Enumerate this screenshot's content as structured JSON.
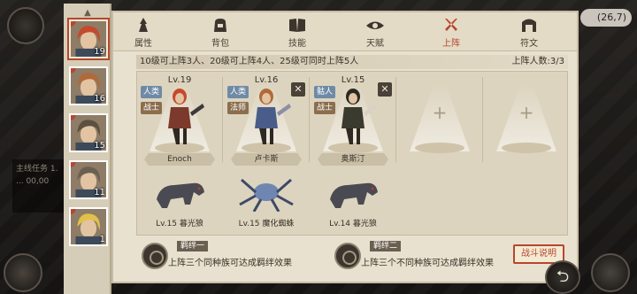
{
  "hud": {
    "coordinates": "(26,7)",
    "task_hint": "主线任务 1. ... 00,00"
  },
  "sidebar": {
    "portraits": [
      {
        "level": "19",
        "hair": "#c54a2d",
        "active": true,
        "removable": true
      },
      {
        "level": "16",
        "hair": "#b06a3a",
        "active": false,
        "removable": true
      },
      {
        "level": "15",
        "hair": "#5c503f",
        "active": false,
        "removable": true
      },
      {
        "level": "11",
        "hair": "#6a5f52",
        "active": false,
        "removable": true
      },
      {
        "level": "1",
        "hair": "#e0c24a",
        "active": false,
        "removable": true
      }
    ]
  },
  "tabs": [
    {
      "label": "属性",
      "icon": "attribute-icon",
      "active": false
    },
    {
      "label": "背包",
      "icon": "backpack-icon",
      "active": false
    },
    {
      "label": "技能",
      "icon": "skill-book-icon",
      "active": false
    },
    {
      "label": "天赋",
      "icon": "talent-eye-icon",
      "active": false
    },
    {
      "label": "上阵",
      "icon": "crossed-swords-icon",
      "active": true
    },
    {
      "label": "符文",
      "icon": "rune-gate-icon",
      "active": false
    }
  ],
  "formation": {
    "rule_text": "10级可上阵3人、20级可上阵4人、25级可同时上阵5人",
    "count_text": "上阵人数:3/3",
    "slots": [
      {
        "level": "Lv.19",
        "tags": [
          "人类",
          "战士"
        ],
        "name": "Enoch",
        "removable": false
      },
      {
        "level": "Lv.16",
        "tags": [
          "人类",
          "法师"
        ],
        "name": "卢卡斯",
        "removable": true
      },
      {
        "level": "Lv.15",
        "tags": [
          "骷人",
          "战士"
        ],
        "name": "奥斯汀",
        "removable": true
      },
      {
        "empty": true
      },
      {
        "empty": true
      }
    ],
    "pets": [
      {
        "text": "Lv.15 暮光狼"
      },
      {
        "text": "Lv.15 魔化蜘蛛"
      },
      {
        "text": "Lv.14 暮光狼"
      }
    ]
  },
  "bonds": [
    {
      "title": "羁绊一",
      "desc": "上阵三个同种族可达成羁绊效果"
    },
    {
      "title": "羁绊二",
      "desc": "上阵三个不同种族可达成羁绊效果"
    }
  ],
  "buttons": {
    "battle_help": "战斗说明"
  },
  "colors": {
    "accent": "#b8462f",
    "panel": "#e8e1cf",
    "tag_human": "#6f8aa6",
    "tag_class": "#8b6e4e"
  }
}
